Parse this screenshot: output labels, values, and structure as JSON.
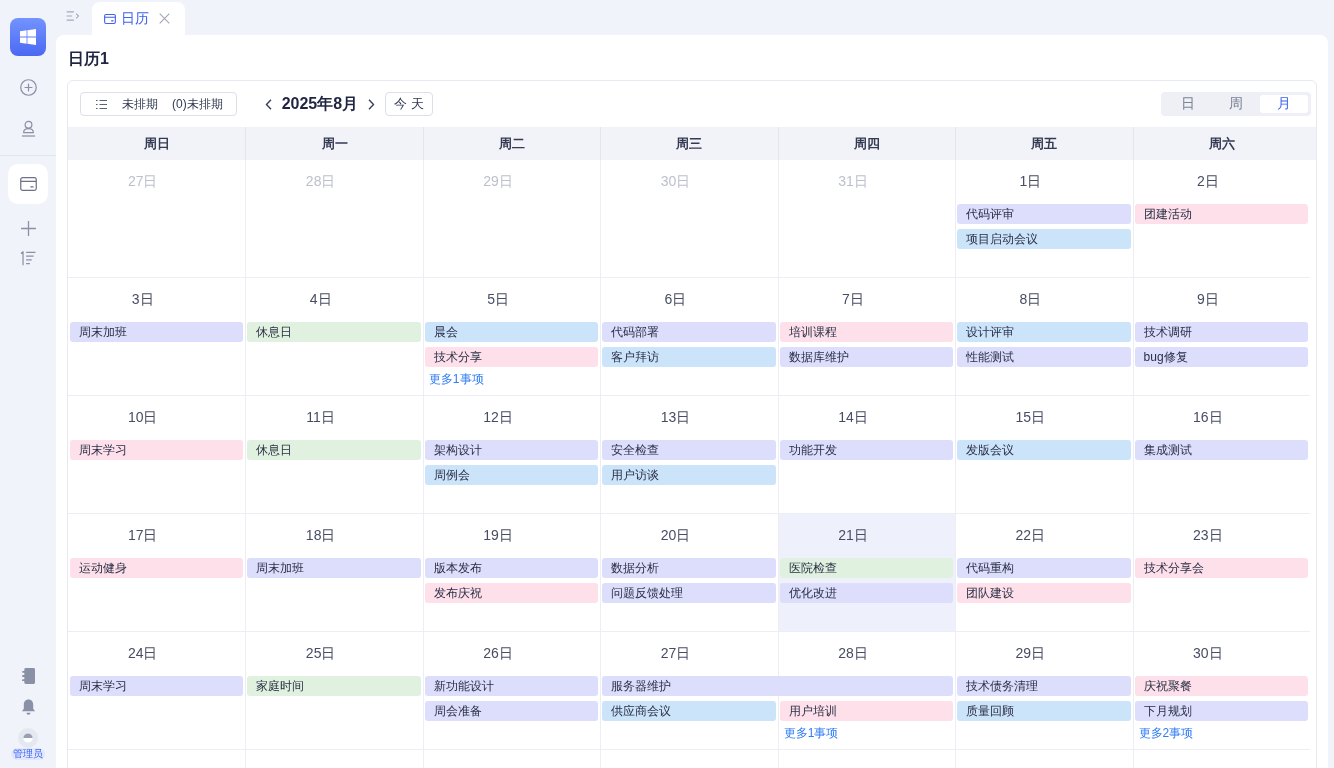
{
  "sidebar": {
    "top_actions": [
      {
        "kind": "create"
      },
      {
        "kind": "profile"
      }
    ],
    "nav_items": [
      {
        "kind": "calendar",
        "selected": true
      },
      {
        "kind": "add",
        "selected": false
      },
      {
        "kind": "sort",
        "selected": false
      }
    ],
    "bottom_actions": [
      {
        "kind": "contacts"
      },
      {
        "kind": "notifications"
      }
    ],
    "user": {
      "name": "管理员"
    }
  },
  "tabs": [
    {
      "label": "日历",
      "selected": true
    }
  ],
  "page_title": "日历1",
  "toolbar": {
    "unscheduled_button": {
      "label": "未排期",
      "count": "(0)未排期"
    },
    "month_title": "2025年8月",
    "today_button": "今 天",
    "views": [
      {
        "label": "日",
        "selected": false
      },
      {
        "label": "周",
        "selected": false
      },
      {
        "label": "月",
        "selected": true
      }
    ]
  },
  "weekdays": [
    "周日",
    "周一",
    "周二",
    "周三",
    "周四",
    "周五",
    "周六"
  ],
  "weeks": [
    {
      "days": [
        {
          "label": "27日",
          "in_month": false,
          "today": false
        },
        {
          "label": "28日",
          "in_month": false,
          "today": false
        },
        {
          "label": "29日",
          "in_month": false,
          "today": false
        },
        {
          "label": "30日",
          "in_month": false,
          "today": false
        },
        {
          "label": "31日",
          "in_month": false,
          "today": false
        },
        {
          "label": "1日",
          "in_month": true,
          "today": false,
          "events": [
            {
              "title": "代码评审",
              "color": "#dcdefc",
              "continues": false
            },
            {
              "title": "项目启动会议",
              "color": "#cbe4fa",
              "continues": false
            }
          ]
        },
        {
          "label": "2日",
          "in_month": true,
          "today": false,
          "events": [
            {
              "title": "团建活动",
              "color": "#fde0ea",
              "continues": false
            }
          ]
        }
      ]
    },
    {
      "days": [
        {
          "label": "3日",
          "in_month": true,
          "today": false,
          "events": [
            {
              "title": "周末加班",
              "color": "#dcdefc",
              "continues": false
            }
          ]
        },
        {
          "label": "4日",
          "in_month": true,
          "today": false,
          "events": [
            {
              "title": "休息日",
              "color": "#e0f2df",
              "continues": false
            }
          ]
        },
        {
          "label": "5日",
          "in_month": true,
          "today": false,
          "events": [
            {
              "title": "晨会",
              "color": "#cbe4fa",
              "continues": false
            },
            {
              "title": "技术分享",
              "color": "#fde0ea",
              "continues": false
            }
          ],
          "more": "更多1事项"
        },
        {
          "label": "6日",
          "in_month": true,
          "today": false,
          "events": [
            {
              "title": "代码部署",
              "color": "#dcdefc",
              "continues": false
            },
            {
              "title": "客户拜访",
              "color": "#cbe4fa",
              "continues": false
            }
          ]
        },
        {
          "label": "7日",
          "in_month": true,
          "today": false,
          "events": [
            {
              "title": "培训课程",
              "color": "#fde0ea",
              "continues": false
            },
            {
              "title": "数据库维护",
              "color": "#dcdefc",
              "continues": false
            }
          ]
        },
        {
          "label": "8日",
          "in_month": true,
          "today": false,
          "events": [
            {
              "title": "设计评审",
              "color": "#cbe4fa",
              "continues": false
            },
            {
              "title": "性能测试",
              "color": "#dcdefc",
              "continues": false
            }
          ]
        },
        {
          "label": "9日",
          "in_month": true,
          "today": false,
          "events": [
            {
              "title": "技术调研",
              "color": "#dcdefc",
              "continues": false
            },
            {
              "title": "bug修复",
              "color": "#dcdefc",
              "continues": false
            }
          ]
        }
      ]
    },
    {
      "days": [
        {
          "label": "10日",
          "in_month": true,
          "today": false,
          "events": [
            {
              "title": "周末学习",
              "color": "#fde0ea",
              "continues": false
            }
          ]
        },
        {
          "label": "11日",
          "in_month": true,
          "today": false,
          "events": [
            {
              "title": "休息日",
              "color": "#e0f2df",
              "continues": false
            }
          ]
        },
        {
          "label": "12日",
          "in_month": true,
          "today": false,
          "events": [
            {
              "title": "架构设计",
              "color": "#dcdefc",
              "continues": false
            },
            {
              "title": "周例会",
              "color": "#cbe4fa",
              "continues": false
            }
          ]
        },
        {
          "label": "13日",
          "in_month": true,
          "today": false,
          "events": [
            {
              "title": "安全检查",
              "color": "#dcdefc",
              "continues": false
            },
            {
              "title": "用户访谈",
              "color": "#cbe4fa",
              "continues": false
            }
          ]
        },
        {
          "label": "14日",
          "in_month": true,
          "today": false,
          "events": [
            {
              "title": "功能开发",
              "color": "#dcdefc",
              "continues": false
            }
          ]
        },
        {
          "label": "15日",
          "in_month": true,
          "today": false,
          "events": [
            {
              "title": "发版会议",
              "color": "#cbe4fa",
              "continues": false
            }
          ]
        },
        {
          "label": "16日",
          "in_month": true,
          "today": false,
          "events": [
            {
              "title": "集成测试",
              "color": "#dcdefc",
              "continues": false
            }
          ]
        }
      ]
    },
    {
      "days": [
        {
          "label": "17日",
          "in_month": true,
          "today": false,
          "events": [
            {
              "title": "运动健身",
              "color": "#fde0ea",
              "continues": false
            }
          ]
        },
        {
          "label": "18日",
          "in_month": true,
          "today": false,
          "events": [
            {
              "title": "周末加班",
              "color": "#dcdefc",
              "continues": false
            }
          ]
        },
        {
          "label": "19日",
          "in_month": true,
          "today": false,
          "events": [
            {
              "title": "版本发布",
              "color": "#dcdefc",
              "continues": false
            },
            {
              "title": "发布庆祝",
              "color": "#fde0ea",
              "continues": false
            }
          ]
        },
        {
          "label": "20日",
          "in_month": true,
          "today": false,
          "events": [
            {
              "title": "数据分析",
              "color": "#dcdefc",
              "continues": false
            },
            {
              "title": "问题反馈处理",
              "color": "#dcdefc",
              "continues": false
            }
          ]
        },
        {
          "label": "21日",
          "in_month": true,
          "today": true,
          "events": [
            {
              "title": "医院检查",
              "color": "#e0f2df",
              "continues": false
            },
            {
              "title": "优化改进",
              "color": "#dcdefc",
              "continues": false
            }
          ]
        },
        {
          "label": "22日",
          "in_month": true,
          "today": false,
          "events": [
            {
              "title": "代码重构",
              "color": "#dcdefc",
              "continues": false
            },
            {
              "title": "团队建设",
              "color": "#fde0ea",
              "continues": false
            }
          ]
        },
        {
          "label": "23日",
          "in_month": true,
          "today": false,
          "events": [
            {
              "title": "技术分享会",
              "color": "#fde0ea",
              "continues": false
            }
          ]
        }
      ]
    },
    {
      "days": [
        {
          "label": "24日",
          "in_month": true,
          "today": false,
          "events": [
            {
              "title": "周末学习",
              "color": "#dcdefc",
              "continues": false
            }
          ]
        },
        {
          "label": "25日",
          "in_month": true,
          "today": false,
          "events": [
            {
              "title": "家庭时间",
              "color": "#e0f2df",
              "continues": false
            }
          ]
        },
        {
          "label": "26日",
          "in_month": true,
          "today": false,
          "events": [
            {
              "title": "新功能设计",
              "color": "#dcdefc",
              "continues": false
            },
            {
              "title": "周会准备",
              "color": "#dcdefc",
              "continues": false
            }
          ]
        },
        {
          "label": "27日",
          "in_month": true,
          "today": false,
          "events": [
            {
              "title": "服务器维护",
              "color": "#dcdefc",
              "continues": true
            },
            {
              "title": "供应商会议",
              "color": "#cbe4fa",
              "continues": false
            }
          ]
        },
        {
          "label": "28日",
          "in_month": true,
          "today": false,
          "events": [
            {
              "title": "用户培训",
              "color": "#fde0ea",
              "continues": false
            }
          ],
          "more": "更多1事项"
        },
        {
          "label": "29日",
          "in_month": true,
          "today": false,
          "events": [
            {
              "title": "技术债务清理",
              "color": "#dcdefc",
              "continues": false
            },
            {
              "title": "质量回顾",
              "color": "#cbe4fa",
              "continues": false
            }
          ]
        },
        {
          "label": "30日",
          "in_month": true,
          "today": false,
          "events": [
            {
              "title": "庆祝聚餐",
              "color": "#fde0ea",
              "continues": false
            },
            {
              "title": "下月规划",
              "color": "#dcdefc",
              "continues": false
            }
          ],
          "more": "更多2事项"
        }
      ]
    }
  ]
}
